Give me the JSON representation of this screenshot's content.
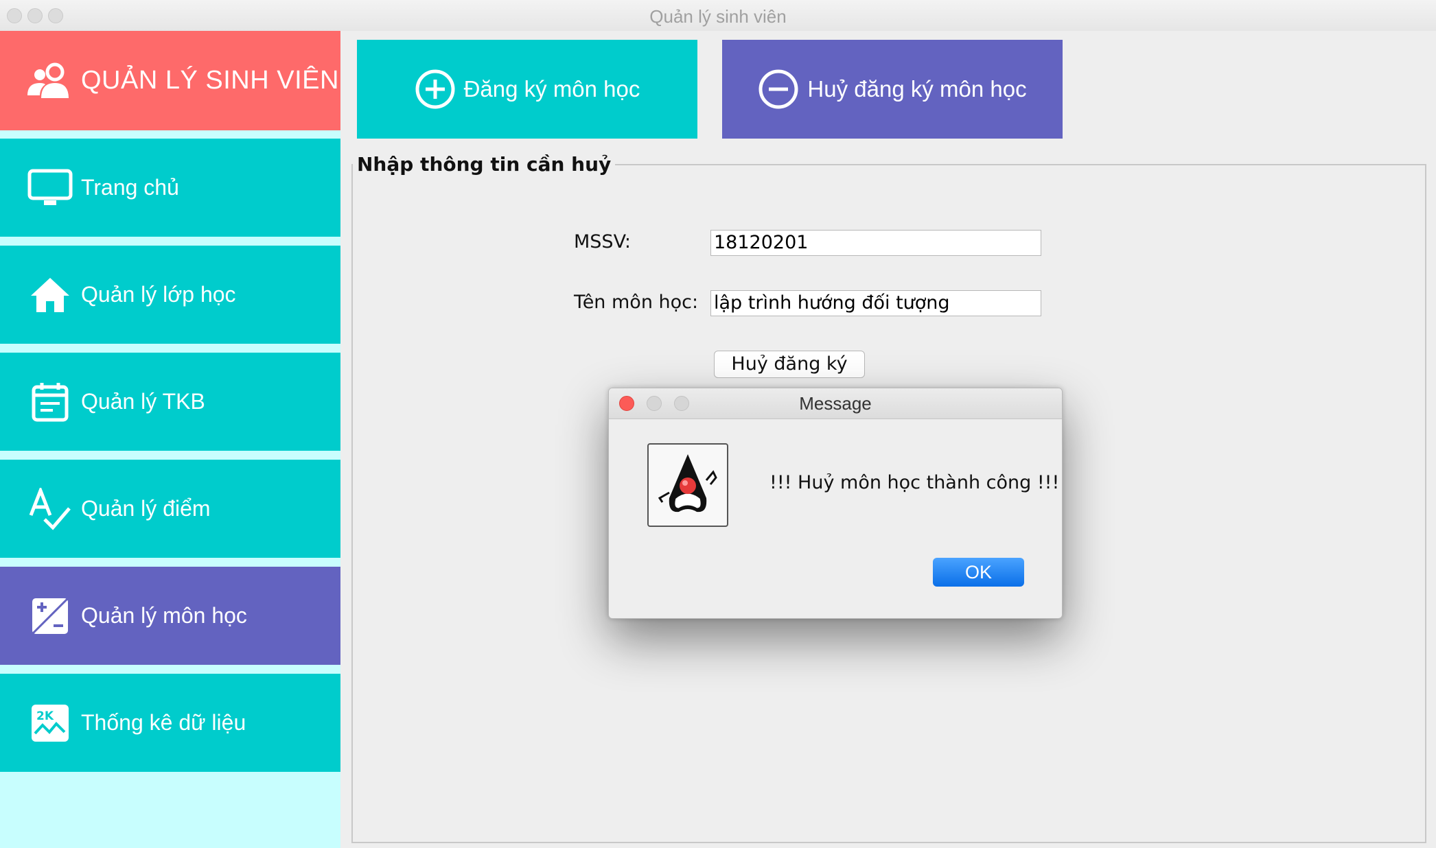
{
  "window": {
    "title": "Quản lý sinh viên"
  },
  "sidebar": {
    "header": {
      "label": "QUẢN LÝ SINH VIÊN",
      "icon": "users-icon"
    },
    "items": [
      {
        "label": "Trang chủ",
        "icon": "monitor-icon",
        "active": false
      },
      {
        "label": "Quản lý lớp học",
        "icon": "home-icon",
        "active": false
      },
      {
        "label": "Quản lý TKB",
        "icon": "calendar-icon",
        "active": false
      },
      {
        "label": "Quản lý điểm",
        "icon": "spellcheck-icon",
        "active": false
      },
      {
        "label": "Quản lý môn học",
        "icon": "plus-minus-icon",
        "active": true
      },
      {
        "label": "Thống kê dữ liệu",
        "icon": "chart-icon",
        "active": false
      }
    ]
  },
  "tabs": {
    "register": "Đăng ký môn học",
    "cancel": "Huỷ đăng ký môn học"
  },
  "form": {
    "legend": "Nhập thông tin cần huỷ",
    "mssv_label": "MSSV:",
    "mssv_value": "18120201",
    "course_label": "Tên môn học:",
    "course_value": "lập trình hướng đối tượng",
    "submit": "Huỷ đăng ký"
  },
  "dialog": {
    "title": "Message",
    "message": "!!! Huỷ môn học thành công !!!",
    "ok": "OK"
  },
  "colors": {
    "sidebar_header": "#fe6a6a",
    "sidebar_item": "#00cccc",
    "sidebar_active": "#6363c0",
    "sidebar_bg": "#c8fefe"
  }
}
